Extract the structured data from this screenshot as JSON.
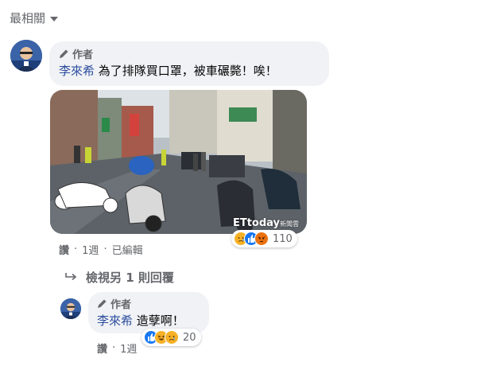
{
  "sort": {
    "label": "最相關",
    "icon": "chevron-down-icon"
  },
  "comment": {
    "author_badge": "作者",
    "author_name": "李來希",
    "text": "為了排隊買口罩，被車碾斃！唉！",
    "photo_watermark": "ETtoday",
    "photo_watermark_sub": "新聞雲",
    "reactions": {
      "icons": [
        "sad",
        "like",
        "angry"
      ],
      "count": "110"
    },
    "actions": {
      "like": "讚",
      "time": "1週",
      "edited": "已編輯"
    }
  },
  "replies_link": {
    "label": "檢視另 1 則回覆",
    "icon": "reply-arrow-icon"
  },
  "reply": {
    "author_badge": "作者",
    "author_name": "李來希",
    "text": "造孽啊！",
    "reactions": {
      "icons": [
        "like",
        "haha",
        "sad"
      ],
      "count": "20"
    },
    "actions": {
      "like": "讚",
      "time": "1週"
    }
  },
  "colors": {
    "like_blue": "#1877f2",
    "sad_yellow": "#f7b125",
    "angry_orange": "#e9710f",
    "link_blue": "#2d4e9e"
  }
}
